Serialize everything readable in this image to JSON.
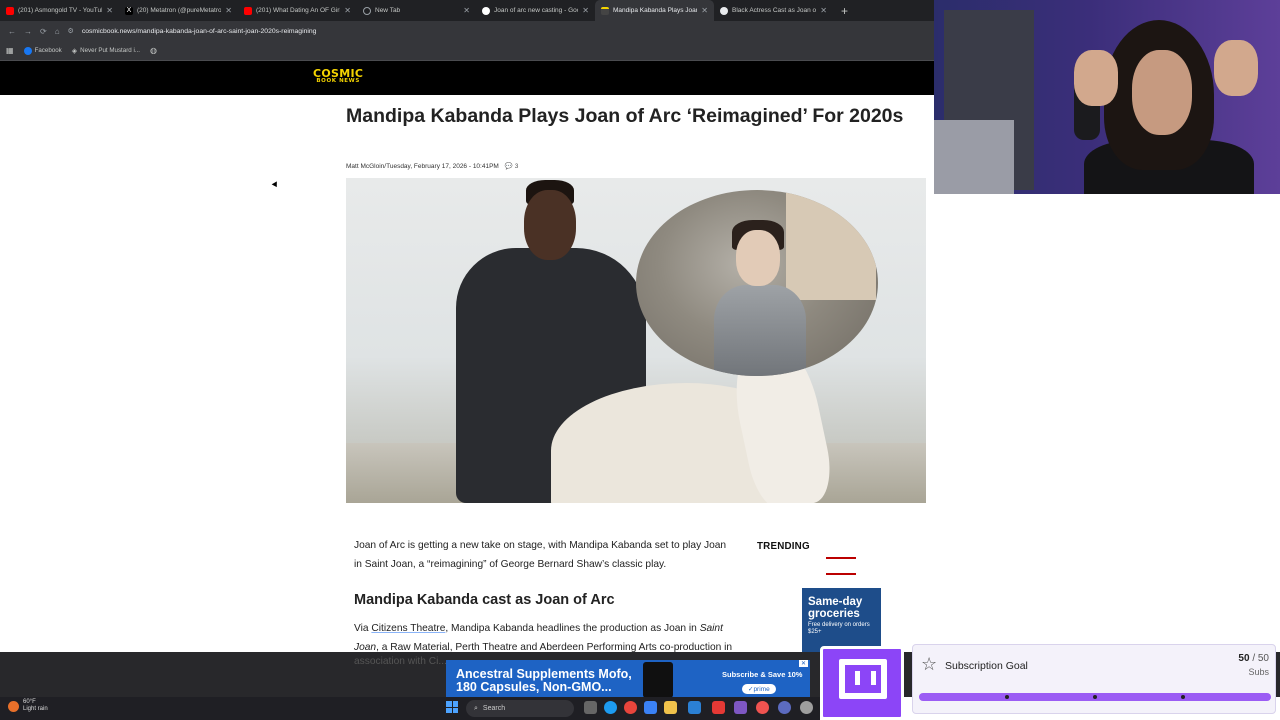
{
  "browser": {
    "tabs": [
      {
        "title": "(201) Asmongold TV - YouTube",
        "icon": "youtube-icon",
        "color": "#ff0000"
      },
      {
        "title": "(20) Metatron (@pureMetatron",
        "icon": "x-icon",
        "color": "#ffffff"
      },
      {
        "title": "(201) What Dating An OF Girl Is",
        "icon": "youtube-icon",
        "color": "#ff0000"
      },
      {
        "title": "New Tab",
        "icon": "globe-icon",
        "color": "#9aa0a6"
      },
      {
        "title": "Joan of arc new casting - Goog",
        "icon": "google-icon",
        "color": "#ffffff"
      },
      {
        "title": "Mandipa Kabanda Plays Joan o",
        "icon": "site-icon",
        "color": "#e8eaed"
      },
      {
        "title": "Black Actress Cast as Joan of Ar",
        "icon": "site-icon",
        "color": "#e8eaed"
      }
    ],
    "url": "cosmicbook.news/mandipa-kabanda-joan-of-arc-saint-joan-2020s-reimagining",
    "bookmarks": [
      "Facebook",
      "Never Put Mustard i..."
    ]
  },
  "site": {
    "logo_line1": "COSMIC",
    "logo_line2": "BOOK NEWS",
    "accent": "#f5d400"
  },
  "article": {
    "title": "Mandipa Kabanda Plays Joan of Arc ‘Reimagined’ For 2020s",
    "author": "Matt McGloin",
    "date": "Tuesday, February 17, 2026 - 10:41PM",
    "comments": "3",
    "para1": "Joan of Arc is getting a new take on stage, with Mandipa Kabanda set to play Joan in Saint Joan, a “reimagining” of George Bernard Shaw’s classic play.",
    "h2": "Mandipa Kabanda cast as Joan of Arc",
    "para2_prefix": "Via ",
    "para2_link": "Citizens Theatre",
    "para2_mid": ", Mandipa Kabanda headlines the production as Joan in ",
    "para2_em": "Saint Joan",
    "para2_rest": ", a Raw Material, Perth Theatre and Aberdeen Performing Arts co-production in",
    "para2_cut": "association with Ci..."
  },
  "sidebar": {
    "trending": "TRENDING",
    "ad_big": "Same-day groceries",
    "ad_small": "Free delivery on orders $25+"
  },
  "ad_banner": {
    "line1": "Ancestral Supplements Mofo,",
    "line2": "180 Capsules, Non-GMO...",
    "cta": "Subscribe & Save 10%",
    "prime": "✓prime"
  },
  "sub_goal": {
    "label": "Subscription Goal",
    "current": "50",
    "total": "/ 50",
    "unit": "Subs",
    "progress": 1.0
  },
  "taskbar": {
    "temp": "60°F",
    "weather": "Light rain",
    "search": "Search"
  }
}
